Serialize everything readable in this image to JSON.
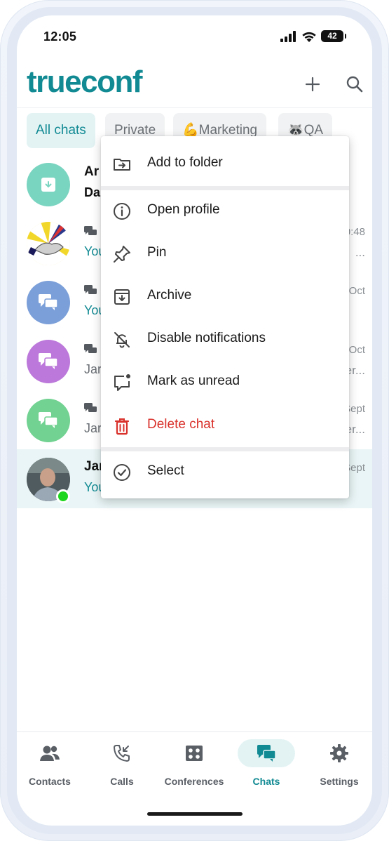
{
  "status_bar": {
    "time": "12:05",
    "battery": "42"
  },
  "header": {
    "logo": "trueconf",
    "add_icon": "plus-icon",
    "search_icon": "search-icon"
  },
  "chips": [
    {
      "label": "All chats",
      "active": true
    },
    {
      "label": "Private"
    },
    {
      "label": "💪Marketing"
    },
    {
      "label": "🦝QA"
    }
  ],
  "chats": [
    {
      "title": "Ar",
      "subtitle": "Da",
      "avatar_color": "#79d4c0"
    },
    {
      "time": "0:48",
      "preview": "You",
      "preview_end": "..."
    },
    {
      "time": "Oct",
      "preview": "You",
      "avatar_color": "#7b9fd9"
    },
    {
      "time": "Oct",
      "preview": "Jar",
      "preview_end": "er...",
      "avatar_color": "#bc78da"
    },
    {
      "time": "Sept",
      "preview": "Jar",
      "preview_end": "er...",
      "avatar_color": "#71d291"
    },
    {
      "title": "Jar",
      "time": "Sept",
      "preview": "You"
    }
  ],
  "menu": {
    "items": [
      {
        "label": "Add to folder",
        "icon": "folder-move-icon"
      },
      {
        "label": "Open profile",
        "icon": "info-icon"
      },
      {
        "label": "Pin",
        "icon": "pin-icon"
      },
      {
        "label": "Archive",
        "icon": "archive-icon"
      },
      {
        "label": "Disable notifications",
        "icon": "bell-off-icon"
      },
      {
        "label": "Mark as unread",
        "icon": "mark-unread-icon"
      },
      {
        "label": "Delete chat",
        "icon": "trash-icon"
      },
      {
        "label": "Select",
        "icon": "check-circle-icon"
      }
    ]
  },
  "bottom_nav": [
    {
      "label": "Contacts"
    },
    {
      "label": "Calls"
    },
    {
      "label": "Conferences"
    },
    {
      "label": "Chats",
      "active": true
    },
    {
      "label": "Settings"
    }
  ],
  "colors": {
    "accent": "#128a93",
    "danger": "#d9312b",
    "online": "#1ed61e"
  }
}
